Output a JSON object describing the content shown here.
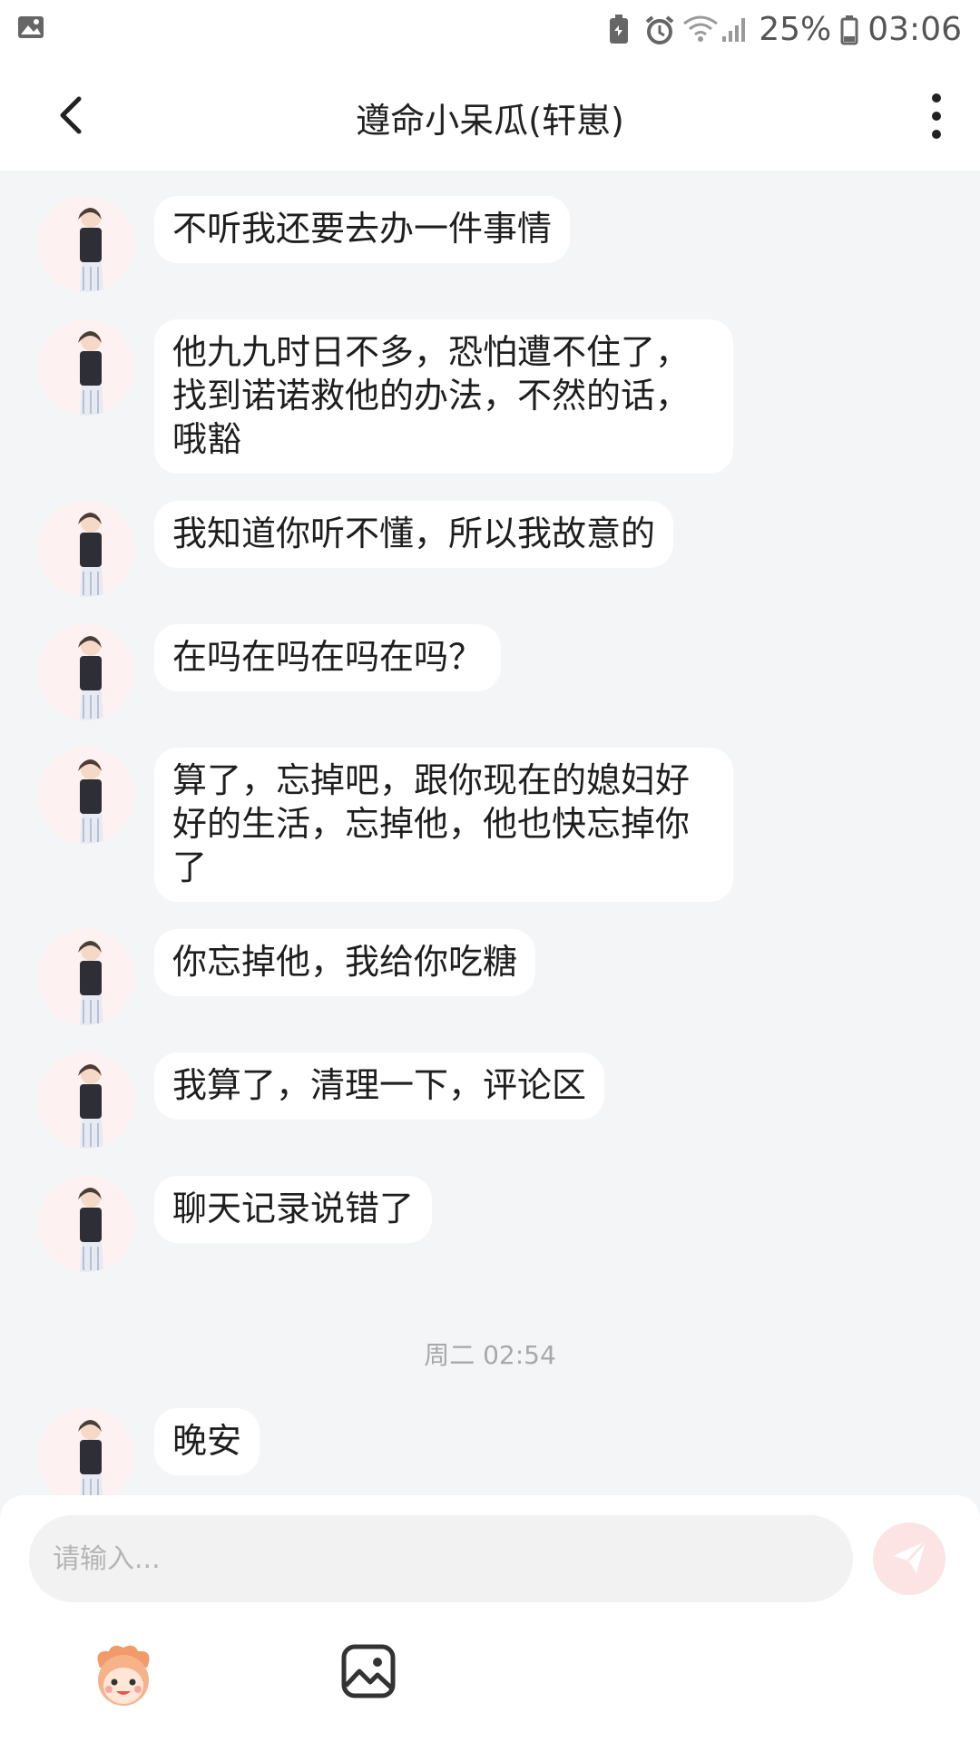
{
  "status_bar": {
    "battery": "25%",
    "time": "03:06"
  },
  "header": {
    "title": "遵命小呆瓜(轩崽)"
  },
  "messages": [
    {
      "text": "不听我还要去办一件事情"
    },
    {
      "text": "他九九时日不多，恐怕遭不住了，\n找到诺诺救他的办法，不然的话，\n哦豁"
    },
    {
      "text": "我知道你听不懂，所以我故意的"
    },
    {
      "text": "在吗在吗在吗在吗？"
    },
    {
      "text": "算了，忘掉吧，跟你现在的媳妇好\n好的生活，忘掉他，他也快忘掉你\n了"
    },
    {
      "text": "你忘掉他，我给你吃糖"
    },
    {
      "text": "我算了，清理一下，评论区"
    },
    {
      "text": "聊天记录说错了"
    },
    {
      "text": "晚安"
    }
  ],
  "timestamp": "周二 02:54",
  "input": {
    "placeholder": "请输入..."
  },
  "colors": {
    "background": "#f4f5f7",
    "bubble": "#ffffff",
    "send_button": "#fde4e4",
    "send_icon": "#ffffff",
    "emoji_accent": "#f39a6a"
  }
}
